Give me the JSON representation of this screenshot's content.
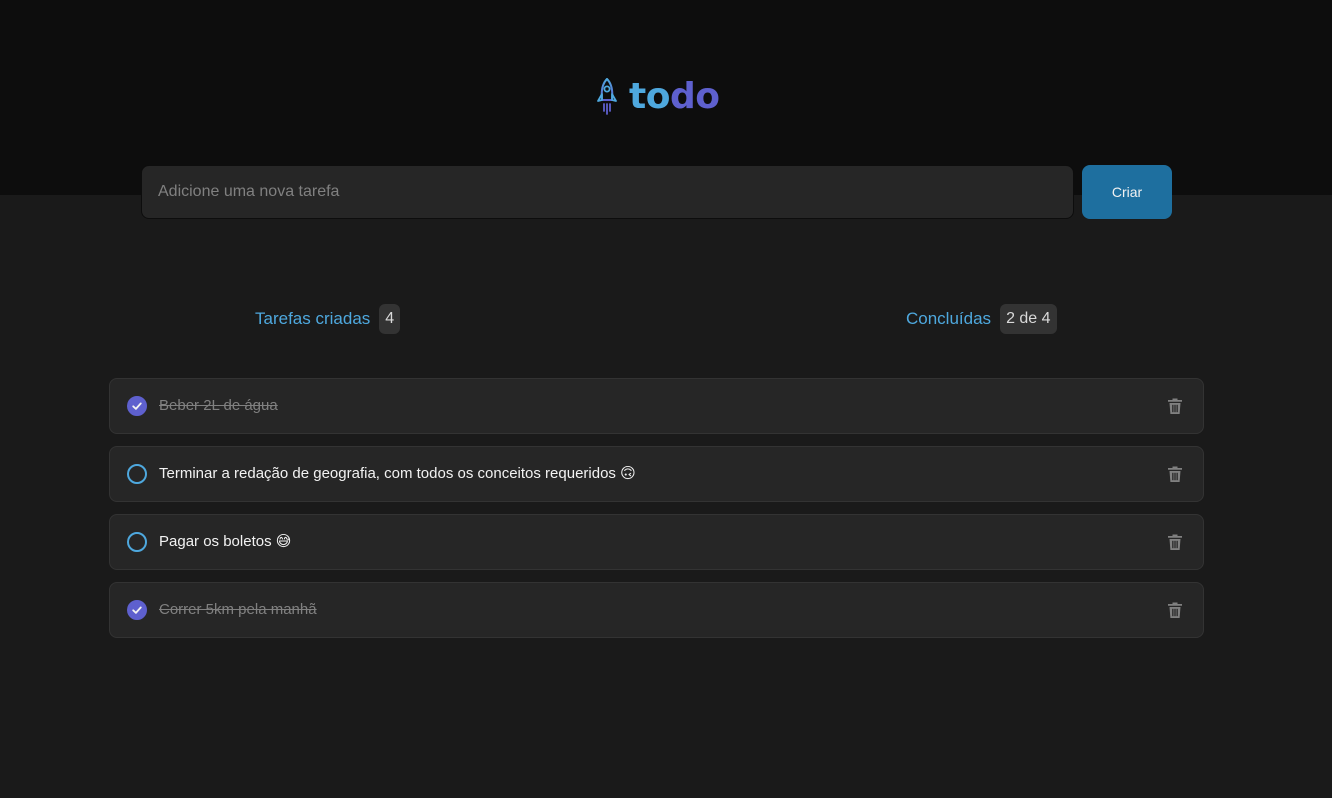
{
  "app": {
    "logo_part1": "to",
    "logo_part2": "do",
    "logo_icon": "rocket-icon"
  },
  "new_task": {
    "placeholder": "Adicione uma nova tarefa",
    "value": "",
    "button_label": "Criar"
  },
  "counters": {
    "created_label": "Tarefas criadas",
    "created_value": "4",
    "done_label": "Concluídas",
    "done_value": "2 de 4"
  },
  "tasks": [
    {
      "text": "Beber 2L de água",
      "completed": true
    },
    {
      "text": "Terminar a redação de geografia, com todos os conceitos requeridos 🙃",
      "completed": false
    },
    {
      "text": "Pagar os boletos 😅",
      "completed": false
    },
    {
      "text": "Correr 5km pela manhã",
      "completed": true
    }
  ],
  "icons": {
    "check": "check-icon",
    "delete": "trash-icon"
  },
  "colors": {
    "blue": "#4ea8de",
    "purple": "#5e60ce",
    "button": "#1e6f9f",
    "background": "#1a1a1a",
    "header": "#0d0d0d",
    "card": "#262626"
  }
}
